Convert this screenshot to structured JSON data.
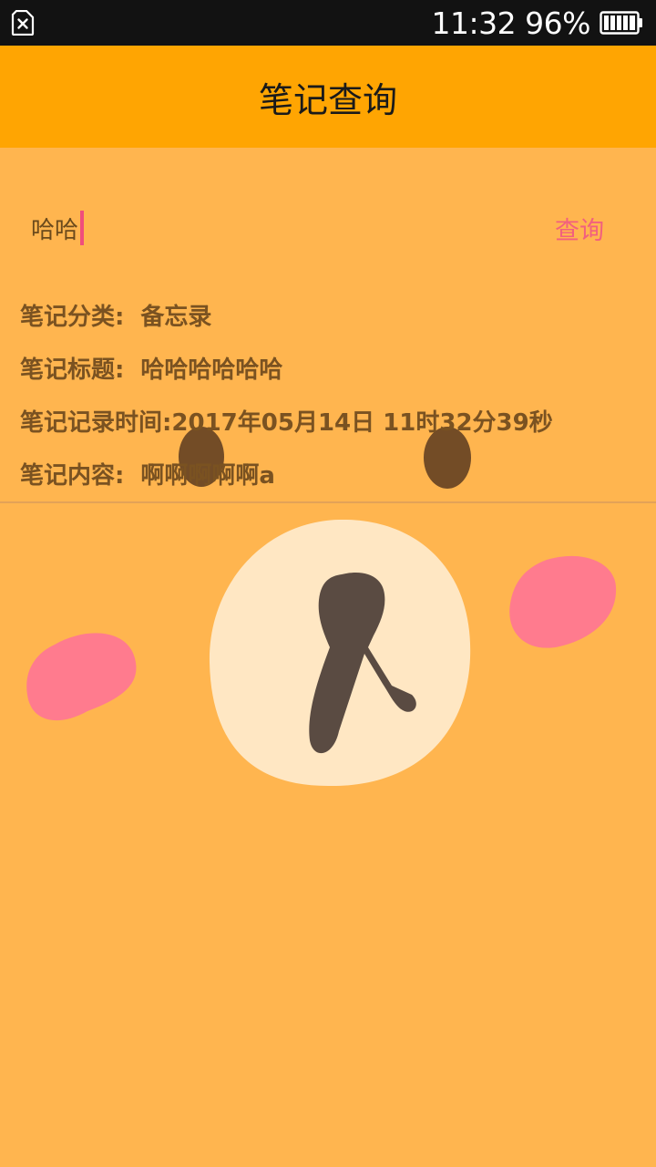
{
  "status_bar": {
    "time": "11:32",
    "battery_percent": "96%",
    "sim_icon": "no-sim-icon",
    "battery_icon": "battery-icon"
  },
  "header": {
    "title": "笔记查询",
    "background": "#FFA502"
  },
  "search": {
    "value": "哈哈",
    "button_label": "查询",
    "caret_color": "#F04E7C"
  },
  "result": {
    "category_label": "笔记分类:",
    "category_value": "备忘录",
    "title_label": "笔记标题:",
    "title_value": "哈哈哈哈哈哈",
    "time_label": "笔记记录时间:",
    "time_value": "2017年05月14日 11时32分39秒",
    "content_label": "笔记内容:",
    "content_value": "啊啊啊啊啊a"
  },
  "theme": {
    "page_background": "#FFB54F",
    "text_color": "#7A5221",
    "accent": "#F2607E"
  }
}
